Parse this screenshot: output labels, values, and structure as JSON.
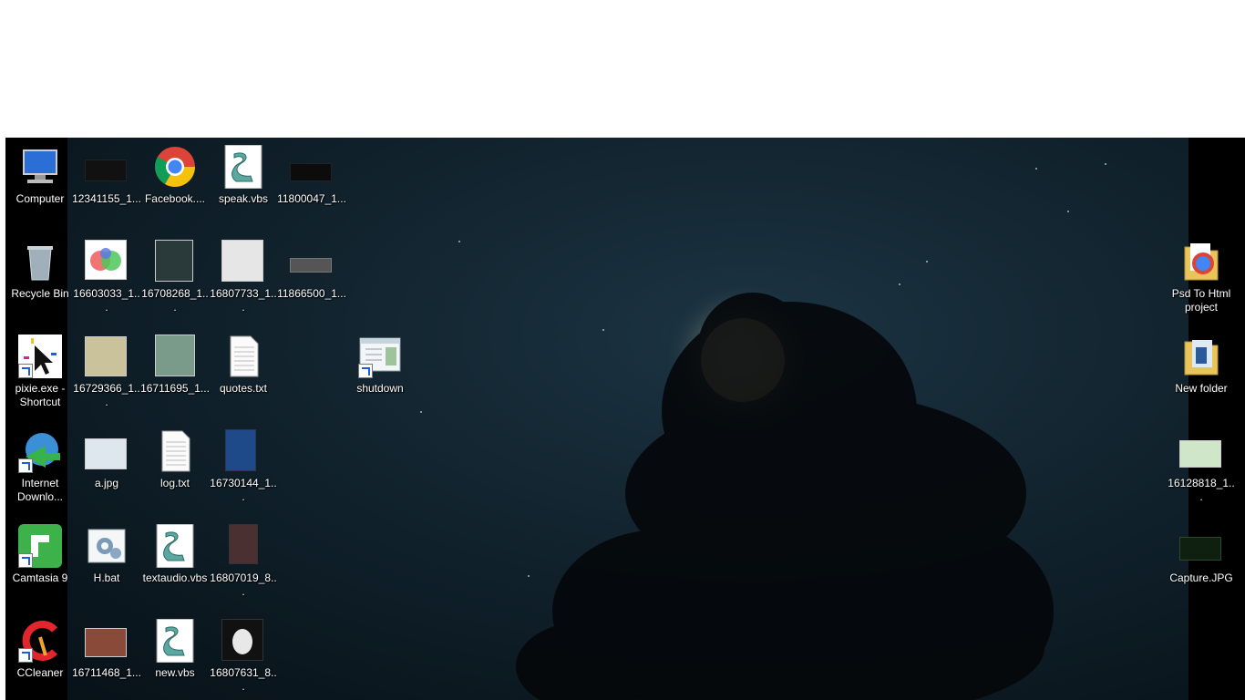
{
  "desktop": {
    "icons": [
      {
        "label": "Computer",
        "icon": "computer-icon"
      },
      {
        "label": "12341155_1...",
        "icon": "image-thumbnail-icon"
      },
      {
        "label": "Facebook....",
        "icon": "chrome-icon"
      },
      {
        "label": "speak.vbs",
        "icon": "script-icon"
      },
      {
        "label": "11800047_1...",
        "icon": "image-thumbnail-icon"
      },
      {
        "label": "Recycle Bin",
        "icon": "recycle-bin-icon"
      },
      {
        "label": "16603033_1...",
        "icon": "image-thumbnail-icon"
      },
      {
        "label": "16708268_1...",
        "icon": "image-thumbnail-icon"
      },
      {
        "label": "16807733_1...",
        "icon": "image-thumbnail-icon"
      },
      {
        "label": "11866500_1...",
        "icon": "image-thumbnail-icon"
      },
      {
        "label": "Psd To Html project",
        "icon": "folder-icon"
      },
      {
        "label": "pixie.exe - Shortcut",
        "icon": "pixie-icon"
      },
      {
        "label": "16729366_1...",
        "icon": "image-thumbnail-icon"
      },
      {
        "label": "16711695_1...",
        "icon": "image-thumbnail-icon"
      },
      {
        "label": "quotes.txt",
        "icon": "text-file-icon"
      },
      {
        "label": "shutdown",
        "icon": "shutdown-shortcut-icon"
      },
      {
        "label": "New folder",
        "icon": "folder-icon"
      },
      {
        "label": "Internet Downlo...",
        "icon": "idm-icon"
      },
      {
        "label": "a.jpg",
        "icon": "image-thumbnail-icon"
      },
      {
        "label": "log.txt",
        "icon": "text-file-icon"
      },
      {
        "label": "16730144_1...",
        "icon": "image-thumbnail-icon"
      },
      {
        "label": "16128818_1...",
        "icon": "image-thumbnail-icon"
      },
      {
        "label": "Camtasia 9",
        "icon": "camtasia-icon"
      },
      {
        "label": "H.bat",
        "icon": "batch-file-icon"
      },
      {
        "label": "textaudio.vbs",
        "icon": "script-icon"
      },
      {
        "label": "16807019_8...",
        "icon": "image-thumbnail-icon"
      },
      {
        "label": "Capture.JPG",
        "icon": "image-thumbnail-icon"
      },
      {
        "label": "CCleaner",
        "icon": "ccleaner-icon"
      },
      {
        "label": "16711468_1...",
        "icon": "image-thumbnail-icon"
      },
      {
        "label": "new.vbs",
        "icon": "script-icon"
      },
      {
        "label": "16807631_8...",
        "icon": "image-thumbnail-icon"
      }
    ]
  },
  "colors": {
    "sky_center": "#1c3443",
    "sky_edge": "#071017",
    "moon": "#f1e9b0",
    "label_text": "#ffffff"
  }
}
